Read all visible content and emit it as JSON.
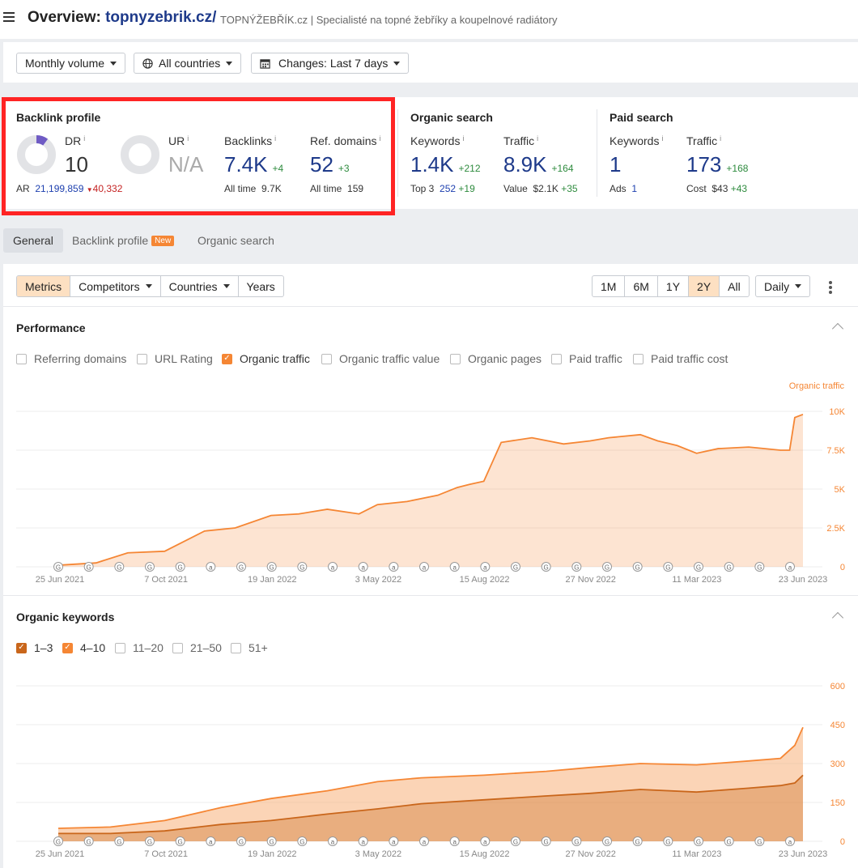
{
  "header": {
    "title_prefix": "Overview:",
    "domain": "topnyzebrik.cz/",
    "site_title": "TOPNÝŽEBŘÍK.cz | Specialisté na topné žebříky a koupelnové radiátory"
  },
  "filters": {
    "volume": "Monthly volume",
    "countries": "All countries",
    "changes": "Changes: Last 7 days"
  },
  "backlink_profile": {
    "title": "Backlink profile",
    "dr_label": "DR",
    "dr_value": "10",
    "dr_fraction": 0.1,
    "ur_label": "UR",
    "ur_value": "N/A",
    "ar_label": "AR",
    "ar_value": "21,199,859",
    "ar_change": "40,332",
    "backlinks_label": "Backlinks",
    "backlinks_value": "7.4K",
    "backlinks_delta": "+4",
    "backlinks_alltime_label": "All time",
    "backlinks_alltime": "9.7K",
    "refdomains_label": "Ref. domains",
    "refdomains_value": "52",
    "refdomains_delta": "+3",
    "refdomains_alltime_label": "All time",
    "refdomains_alltime": "159"
  },
  "organic_search": {
    "title": "Organic search",
    "keywords_label": "Keywords",
    "keywords_value": "1.4K",
    "keywords_delta": "+212",
    "top3_label": "Top 3",
    "top3_value": "252",
    "top3_delta": "+19",
    "traffic_label": "Traffic",
    "traffic_value": "8.9K",
    "traffic_delta": "+164",
    "value_label": "Value",
    "value_value": "$2.1K",
    "value_delta": "+35"
  },
  "paid_search": {
    "title": "Paid search",
    "keywords_label": "Keywords",
    "keywords_value": "1",
    "ads_label": "Ads",
    "ads_value": "1",
    "traffic_label": "Traffic",
    "traffic_value": "173",
    "traffic_delta": "+168",
    "cost_label": "Cost",
    "cost_value": "$43",
    "cost_delta": "+43"
  },
  "tabs": {
    "general": "General",
    "backlink_profile": "Backlink profile",
    "new_badge": "New",
    "organic_search": "Organic search"
  },
  "toolbar": {
    "metrics": "Metrics",
    "competitors": "Competitors",
    "countries": "Countries",
    "years": "Years",
    "ranges": [
      "1M",
      "6M",
      "1Y",
      "2Y",
      "All"
    ],
    "active_range": "2Y",
    "granularity": "Daily"
  },
  "performance": {
    "title": "Performance",
    "checkboxes": {
      "referring_domains": "Referring domains",
      "url_rating": "URL Rating",
      "organic_traffic": "Organic traffic",
      "organic_traffic_value": "Organic traffic value",
      "organic_pages": "Organic pages",
      "paid_traffic": "Paid traffic",
      "paid_traffic_cost": "Paid traffic cost"
    }
  },
  "organic_keywords": {
    "title": "Organic keywords",
    "checkboxes": {
      "pos_1_3": "1–3",
      "pos_4_10": "4–10",
      "pos_11_20": "11–20",
      "pos_21_50": "21–50",
      "pos_51_plus": "51+"
    }
  },
  "colors": {
    "accent": "#f58634",
    "dark_orange": "#c9661b",
    "link_blue": "#1e3a8a",
    "positive": "#2e8b3e",
    "negative": "#c52424",
    "highlight_box": "#ff2424"
  },
  "chart_data": [
    {
      "type": "area",
      "series": [
        {
          "name": "Organic traffic",
          "x": [
            "2021-06-25",
            "2021-08-01",
            "2021-09-01",
            "2021-10-07",
            "2021-11-15",
            "2021-12-15",
            "2022-01-19",
            "2022-02-15",
            "2022-03-15",
            "2022-04-15",
            "2022-05-03",
            "2022-06-01",
            "2022-07-01",
            "2022-07-20",
            "2022-08-01",
            "2022-08-15",
            "2022-09-01",
            "2022-10-01",
            "2022-11-01",
            "2022-11-27",
            "2022-12-15",
            "2023-01-15",
            "2023-02-01",
            "2023-02-20",
            "2023-03-11",
            "2023-04-01",
            "2023-05-01",
            "2023-06-01",
            "2023-06-10",
            "2023-06-15",
            "2023-06-23"
          ],
          "values": [
            100,
            250,
            900,
            1000,
            2300,
            2500,
            3300,
            3400,
            3700,
            3400,
            4000,
            4200,
            4600,
            5100,
            5300,
            5500,
            8000,
            8300,
            7900,
            8100,
            8300,
            8500,
            8100,
            7800,
            7300,
            7600,
            7700,
            7500,
            7500,
            9600,
            9800
          ]
        }
      ],
      "legend": [
        "Organic traffic"
      ],
      "x_tick_labels": [
        "25 Jun 2021",
        "7 Oct 2021",
        "19 Jan 2022",
        "3 May 2022",
        "15 Aug 2022",
        "27 Nov 2022",
        "11 Mar 2023",
        "23 Jun 2023"
      ],
      "y_tick_labels": [
        "0",
        "2.5K",
        "5K",
        "7.5K",
        "10K"
      ],
      "ylim": [
        0,
        10000
      ],
      "y_axis_position": "right",
      "grid": true
    },
    {
      "type": "area",
      "categories": [
        "1–3",
        "4–10"
      ],
      "series": [
        {
          "name": "4–10",
          "x": [
            "2021-06-25",
            "2021-08-15",
            "2021-10-07",
            "2021-12-01",
            "2022-01-19",
            "2022-03-15",
            "2022-05-03",
            "2022-06-15",
            "2022-08-15",
            "2022-10-15",
            "2022-11-27",
            "2023-01-15",
            "2023-03-11",
            "2023-05-01",
            "2023-06-01",
            "2023-06-15",
            "2023-06-23"
          ],
          "values": [
            50,
            55,
            80,
            130,
            165,
            195,
            230,
            245,
            255,
            270,
            285,
            300,
            295,
            310,
            320,
            370,
            440
          ]
        },
        {
          "name": "1–3",
          "x": [
            "2021-06-25",
            "2021-08-15",
            "2021-10-07",
            "2021-12-01",
            "2022-01-19",
            "2022-03-15",
            "2022-05-03",
            "2022-06-15",
            "2022-08-15",
            "2022-10-15",
            "2022-11-27",
            "2023-01-15",
            "2023-03-11",
            "2023-05-01",
            "2023-06-01",
            "2023-06-15",
            "2023-06-23"
          ],
          "values": [
            30,
            30,
            40,
            65,
            80,
            105,
            125,
            145,
            160,
            175,
            185,
            200,
            190,
            205,
            215,
            225,
            255
          ]
        }
      ],
      "x_tick_labels": [
        "25 Jun 2021",
        "7 Oct 2021",
        "19 Jan 2022",
        "3 May 2022",
        "15 Aug 2022",
        "27 Nov 2022",
        "11 Mar 2023",
        "23 Jun 2023"
      ],
      "y_tick_labels": [
        "0",
        "150",
        "300",
        "450",
        "600"
      ],
      "ylim": [
        0,
        600
      ],
      "y_axis_position": "right",
      "grid": true
    }
  ],
  "annotation_markers": {
    "glyphs": {
      "google": "G",
      "ahrefs": "a"
    },
    "chart_markers": [
      "G",
      "G",
      "G",
      "G",
      "G",
      "a",
      "G",
      "G",
      "G",
      "a",
      "a",
      "a",
      "a",
      "a",
      "a",
      "G",
      "G",
      "G",
      "G",
      "G",
      "G",
      "G",
      "G",
      "G",
      "a"
    ]
  }
}
